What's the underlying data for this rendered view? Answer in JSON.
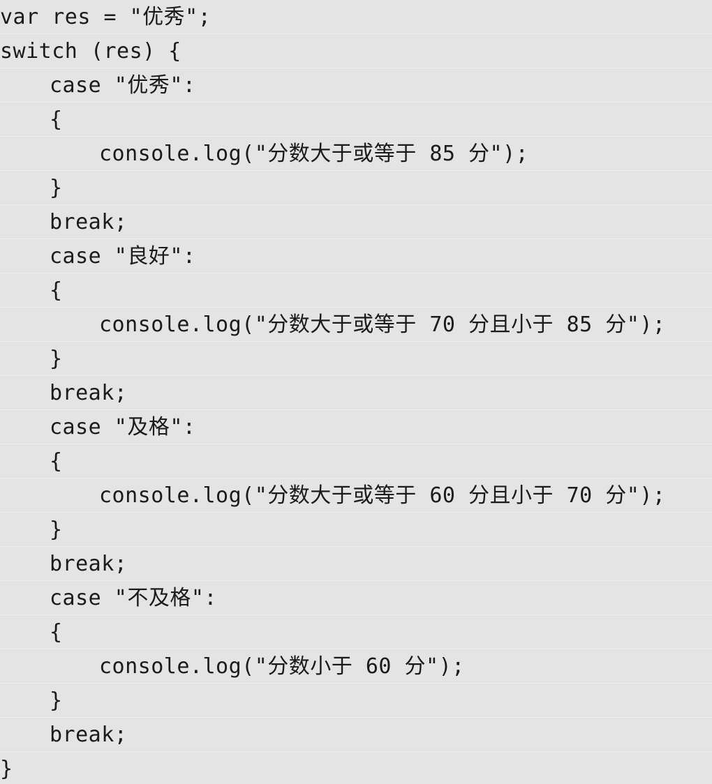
{
  "editor": {
    "language": "JavaScript",
    "background_color": "#e4e4e4",
    "text_color": "#1b1b1b",
    "separator_color": "#ededed",
    "font_size_px": 30,
    "line_height_px": 49
  },
  "code": {
    "lines": [
      {
        "indent": 0,
        "text": "var res = \"优秀\";"
      },
      {
        "indent": 0,
        "text": "switch (res) {"
      },
      {
        "indent": 1,
        "text": "case \"优秀\":"
      },
      {
        "indent": 1,
        "text": "{"
      },
      {
        "indent": 2,
        "text": "console.log(\"分数大于或等于 85 分\");"
      },
      {
        "indent": 1,
        "text": "}"
      },
      {
        "indent": 1,
        "text": "break;"
      },
      {
        "indent": 1,
        "text": "case \"良好\":"
      },
      {
        "indent": 1,
        "text": "{"
      },
      {
        "indent": 2,
        "text": "console.log(\"分数大于或等于 70 分且小于 85 分\");"
      },
      {
        "indent": 1,
        "text": "}"
      },
      {
        "indent": 1,
        "text": "break;"
      },
      {
        "indent": 1,
        "text": "case \"及格\":"
      },
      {
        "indent": 1,
        "text": "{"
      },
      {
        "indent": 2,
        "text": "console.log(\"分数大于或等于 60 分且小于 70 分\");"
      },
      {
        "indent": 1,
        "text": "}"
      },
      {
        "indent": 1,
        "text": "break;"
      },
      {
        "indent": 1,
        "text": "case \"不及格\":"
      },
      {
        "indent": 1,
        "text": "{"
      },
      {
        "indent": 2,
        "text": "console.log(\"分数小于 60 分\");"
      },
      {
        "indent": 1,
        "text": "}"
      },
      {
        "indent": 1,
        "text": "break;"
      },
      {
        "indent": 0,
        "text": "}"
      }
    ]
  }
}
